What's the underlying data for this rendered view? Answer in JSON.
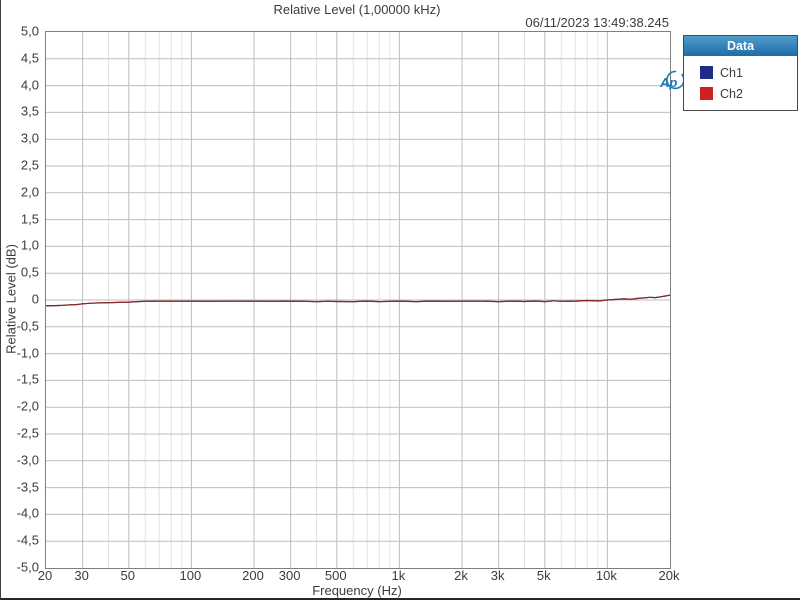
{
  "header": {
    "title": "Relative Level (1,00000 kHz)",
    "timestamp": "06/11/2023 13:49:38.245"
  },
  "logo": {
    "text": "Ap"
  },
  "legend": {
    "header_label": "Data",
    "items": [
      {
        "label": "Ch1",
        "swatch_color": "#1f2c85"
      },
      {
        "label": "Ch2",
        "swatch_color": "#cc2222"
      }
    ]
  },
  "colors": {
    "accent_blue": "#1b7ab8",
    "frame": "#7f7f7f",
    "grid_major": "#bdbdbd",
    "grid_minor": "#e2e2e2",
    "text": "#3c3c3c",
    "ch1_line": "#1f2c85",
    "ch2_line": "#8e2626"
  },
  "chart_data": {
    "type": "line",
    "title": "Relative Level (1,00000 kHz)",
    "xlabel": "Frequency (Hz)",
    "ylabel": "Relative Level (dB)",
    "x_scale": "log",
    "xlim": [
      20,
      20000
    ],
    "ylim": [
      -5,
      5
    ],
    "legend_position": "top-right-outside",
    "grid": {
      "major_freqs": [
        30,
        50,
        100,
        200,
        300,
        500,
        1000,
        2000,
        3000,
        5000,
        10000
      ],
      "minor_freqs": [
        40,
        60,
        70,
        80,
        90,
        400,
        600,
        700,
        800,
        900,
        4000,
        6000,
        7000,
        8000,
        9000
      ],
      "y_values": [
        -4.5,
        -4,
        -3.5,
        -3,
        -2.5,
        -2,
        -1.5,
        -1,
        -0.5,
        0,
        0.5,
        1,
        1.5,
        2,
        2.5,
        3,
        3.5,
        4,
        4.5
      ]
    },
    "xticks": [
      {
        "f": 20,
        "label": "20"
      },
      {
        "f": 30,
        "label": "30"
      },
      {
        "f": 50,
        "label": "50"
      },
      {
        "f": 100,
        "label": "100"
      },
      {
        "f": 200,
        "label": "200"
      },
      {
        "f": 300,
        "label": "300"
      },
      {
        "f": 500,
        "label": "500"
      },
      {
        "f": 1000,
        "label": "1k"
      },
      {
        "f": 2000,
        "label": "2k"
      },
      {
        "f": 3000,
        "label": "3k"
      },
      {
        "f": 5000,
        "label": "5k"
      },
      {
        "f": 10000,
        "label": "10k"
      },
      {
        "f": 20000,
        "label": "20k"
      }
    ],
    "yticks": [
      {
        "v": 5,
        "label": "5,0"
      },
      {
        "v": 4.5,
        "label": "4,5"
      },
      {
        "v": 4,
        "label": "4,0"
      },
      {
        "v": 3.5,
        "label": "3,5"
      },
      {
        "v": 3,
        "label": "3,0"
      },
      {
        "v": 2.5,
        "label": "2,5"
      },
      {
        "v": 2,
        "label": "2,0"
      },
      {
        "v": 1.5,
        "label": "1,5"
      },
      {
        "v": 1,
        "label": "1,0"
      },
      {
        "v": 0.5,
        "label": "0,5"
      },
      {
        "v": 0,
        "label": "0"
      },
      {
        "v": -0.5,
        "label": "-0,5"
      },
      {
        "v": -1,
        "label": "-1,0"
      },
      {
        "v": -1.5,
        "label": "-1,5"
      },
      {
        "v": -2,
        "label": "-2,0"
      },
      {
        "v": -2.5,
        "label": "-2,5"
      },
      {
        "v": -3,
        "label": "-3,0"
      },
      {
        "v": -3.5,
        "label": "-3,5"
      },
      {
        "v": -4,
        "label": "-4,0"
      },
      {
        "v": -4.5,
        "label": "-4,5"
      },
      {
        "v": -5,
        "label": "-5,0"
      }
    ],
    "series": [
      {
        "name": "Ch1",
        "line_color": "#1f2c85",
        "points": [
          [
            20,
            -0.11
          ],
          [
            22,
            -0.105
          ],
          [
            24,
            -0.1
          ],
          [
            26,
            -0.09
          ],
          [
            28,
            -0.085
          ],
          [
            30,
            -0.07
          ],
          [
            33,
            -0.06
          ],
          [
            36,
            -0.055
          ],
          [
            40,
            -0.05
          ],
          [
            45,
            -0.045
          ],
          [
            50,
            -0.04
          ],
          [
            55,
            -0.03
          ],
          [
            60,
            -0.025
          ],
          [
            70,
            -0.02
          ],
          [
            80,
            -0.02
          ],
          [
            90,
            -0.022
          ],
          [
            100,
            -0.02
          ],
          [
            120,
            -0.025
          ],
          [
            140,
            -0.02
          ],
          [
            170,
            -0.022
          ],
          [
            200,
            -0.02
          ],
          [
            250,
            -0.025
          ],
          [
            300,
            -0.02
          ],
          [
            350,
            -0.025
          ],
          [
            400,
            -0.03
          ],
          [
            450,
            -0.025
          ],
          [
            500,
            -0.028
          ],
          [
            600,
            -0.03
          ],
          [
            700,
            -0.02
          ],
          [
            800,
            -0.03
          ],
          [
            900,
            -0.026
          ],
          [
            1000,
            -0.02
          ],
          [
            1200,
            -0.03
          ],
          [
            1400,
            -0.02
          ],
          [
            1700,
            -0.025
          ],
          [
            2000,
            -0.022
          ],
          [
            2500,
            -0.02
          ],
          [
            3000,
            -0.03
          ],
          [
            3500,
            -0.02
          ],
          [
            4000,
            -0.028
          ],
          [
            4500,
            -0.018
          ],
          [
            5000,
            -0.03
          ],
          [
            5500,
            -0.015
          ],
          [
            6000,
            -0.025
          ],
          [
            7000,
            -0.02
          ],
          [
            8000,
            -0.01
          ],
          [
            9000,
            -0.018
          ],
          [
            10000,
            0
          ],
          [
            11000,
            0.012
          ],
          [
            12000,
            0.02
          ],
          [
            13000,
            0.015
          ],
          [
            14000,
            0.03
          ],
          [
            15000,
            0.04
          ],
          [
            16000,
            0.05
          ],
          [
            17000,
            0.045
          ],
          [
            18000,
            0.06
          ],
          [
            19000,
            0.075
          ],
          [
            20000,
            0.09
          ]
        ]
      },
      {
        "name": "Ch2",
        "line_color": "#8e2626",
        "points": [
          [
            20,
            -0.11
          ],
          [
            22,
            -0.105
          ],
          [
            24,
            -0.1
          ],
          [
            26,
            -0.09
          ],
          [
            28,
            -0.085
          ],
          [
            30,
            -0.07
          ],
          [
            33,
            -0.06
          ],
          [
            36,
            -0.055
          ],
          [
            40,
            -0.05
          ],
          [
            45,
            -0.045
          ],
          [
            50,
            -0.04
          ],
          [
            55,
            -0.03
          ],
          [
            60,
            -0.025
          ],
          [
            70,
            -0.02
          ],
          [
            80,
            -0.02
          ],
          [
            90,
            -0.022
          ],
          [
            100,
            -0.02
          ],
          [
            120,
            -0.025
          ],
          [
            140,
            -0.02
          ],
          [
            170,
            -0.022
          ],
          [
            200,
            -0.02
          ],
          [
            250,
            -0.025
          ],
          [
            300,
            -0.02
          ],
          [
            350,
            -0.025
          ],
          [
            400,
            -0.03
          ],
          [
            450,
            -0.025
          ],
          [
            500,
            -0.028
          ],
          [
            600,
            -0.03
          ],
          [
            700,
            -0.02
          ],
          [
            800,
            -0.03
          ],
          [
            900,
            -0.026
          ],
          [
            1000,
            -0.02
          ],
          [
            1200,
            -0.03
          ],
          [
            1400,
            -0.02
          ],
          [
            1700,
            -0.025
          ],
          [
            2000,
            -0.022
          ],
          [
            2500,
            -0.02
          ],
          [
            3000,
            -0.03
          ],
          [
            3500,
            -0.02
          ],
          [
            4000,
            -0.028
          ],
          [
            4500,
            -0.018
          ],
          [
            5000,
            -0.03
          ],
          [
            5500,
            -0.015
          ],
          [
            6000,
            -0.025
          ],
          [
            7000,
            -0.02
          ],
          [
            8000,
            -0.01
          ],
          [
            9000,
            -0.018
          ],
          [
            10000,
            0
          ],
          [
            11000,
            0.012
          ],
          [
            12000,
            0.02
          ],
          [
            13000,
            0.015
          ],
          [
            14000,
            0.03
          ],
          [
            15000,
            0.04
          ],
          [
            16000,
            0.05
          ],
          [
            17000,
            0.045
          ],
          [
            18000,
            0.06
          ],
          [
            19000,
            0.075
          ],
          [
            20000,
            0.09
          ]
        ]
      }
    ]
  }
}
